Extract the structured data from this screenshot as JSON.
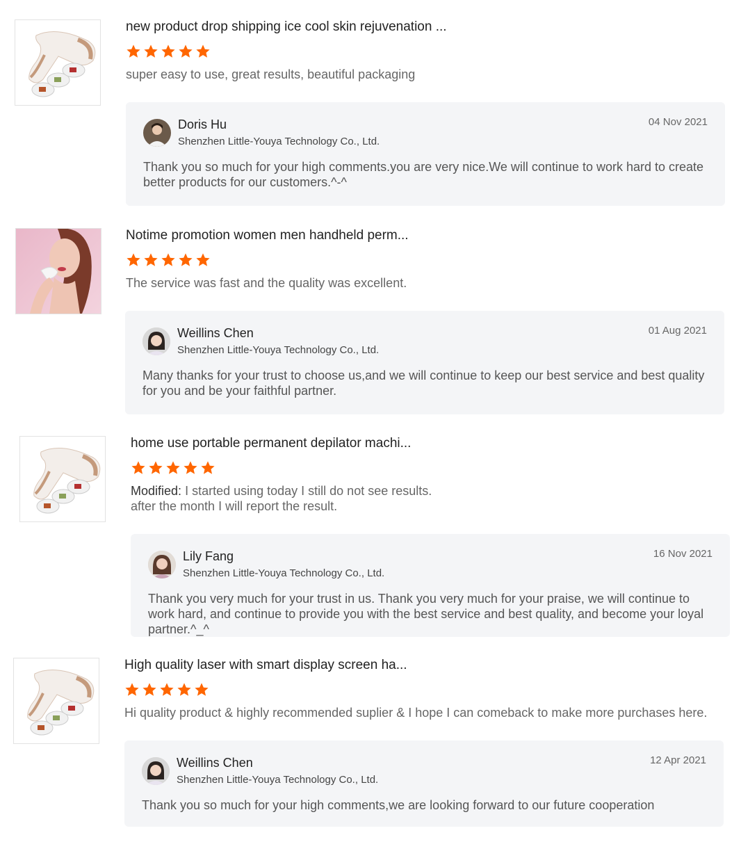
{
  "colors": {
    "star": "#ff6600",
    "reply_bg": "#f4f5f7"
  },
  "reviews": [
    {
      "product_image": "hair-removal-device-image",
      "title": "new product drop shipping ice cool skin rejuvenation ...",
      "rating": 5,
      "modified_label": "",
      "text": "super easy to use, great results, beautiful packaging",
      "reply": {
        "name": "Doris Hu",
        "company": "Shenzhen Little-Youya Technology Co., Ltd.",
        "date": "04 Nov 2021",
        "text": "Thank you so much for your high comments.you are very nice.We will continue to work hard to create better products for our customers.^-^"
      }
    },
    {
      "product_image": "model-with-device-image",
      "title": "Notime promotion women men handheld perm...",
      "rating": 5,
      "modified_label": "",
      "text": "The service was fast and the quality was excellent.",
      "reply": {
        "name": "Weillins Chen",
        "company": "Shenzhen Little-Youya Technology Co., Ltd.",
        "date": "01 Aug 2021",
        "text": "Many thanks for your trust to choose us,and  we will continue to keep our best service and best quality for you and be your faithful partner."
      }
    },
    {
      "product_image": "hair-removal-device-image",
      "title": "home use portable permanent depilator machi...",
      "rating": 5,
      "modified_label": "Modified:",
      "text": "I started using today I still do not see results.",
      "text2": "after the month I will report the result.",
      "reply": {
        "name": "Lily Fang",
        "company": "Shenzhen Little-Youya Technology Co., Ltd.",
        "date": "16 Nov 2021",
        "text": "Thank you very much for your trust in us. Thank you very much for your praise, we will continue to work hard, and continue to provide you with the best service and best quality, and become your loyal partner.^_^"
      }
    },
    {
      "product_image": "hair-removal-device-image",
      "title": "High quality laser with smart display screen ha...",
      "rating": 5,
      "modified_label": "",
      "text": "Hi quality product & highly recommended suplier & I hope I can comeback to make more purchases here.",
      "reply": {
        "name": "Weillins Chen",
        "company": "Shenzhen Little-Youya Technology Co., Ltd.",
        "date": "12 Apr 2021",
        "text": "Thank you so much for your high comments,we are looking forward to our future cooperation"
      }
    }
  ]
}
